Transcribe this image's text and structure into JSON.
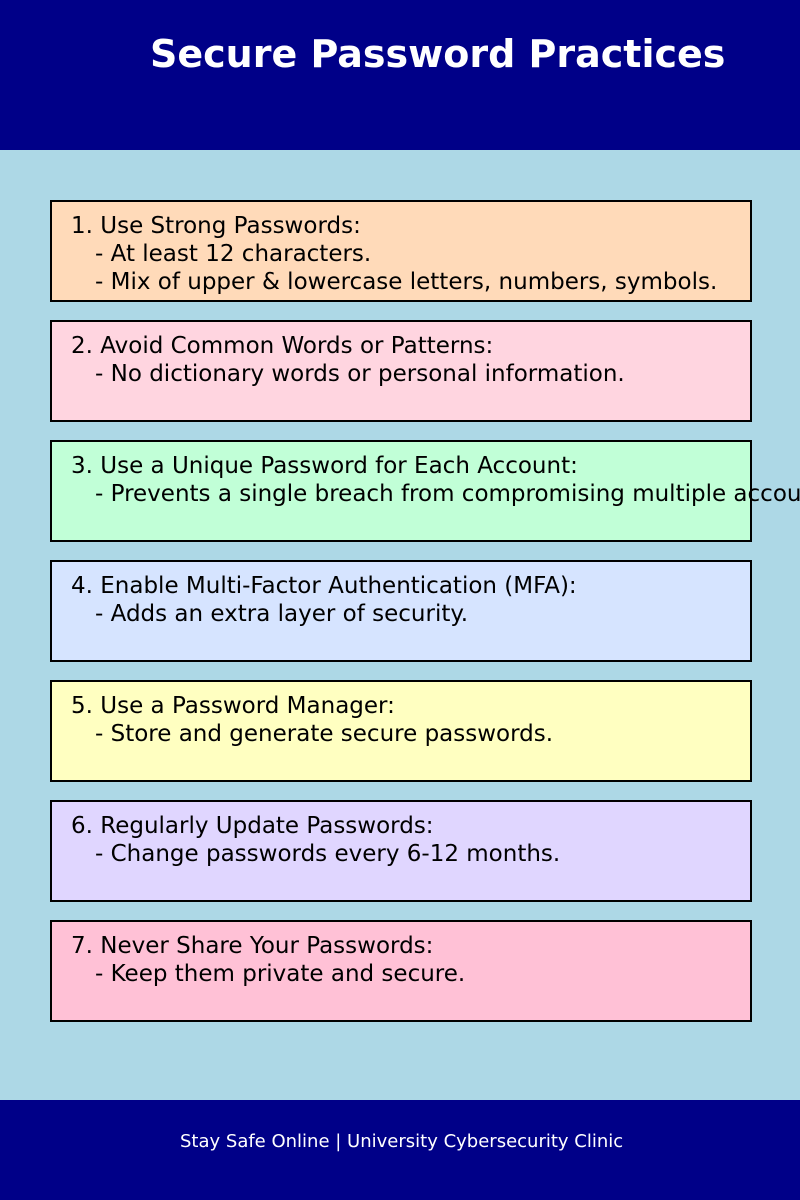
{
  "header": {
    "title": "Secure Password Practices",
    "background": "#000088"
  },
  "page": {
    "background": "#add8e6"
  },
  "tips": [
    {
      "heading": "1. Use Strong Passwords:",
      "details": [
        "- At least 12 characters.",
        "- Mix of upper & lowercase letters, numbers, symbols."
      ],
      "color": "#ffdab9"
    },
    {
      "heading": "2. Avoid Common Words or Patterns:",
      "details": [
        "- No dictionary words or personal information."
      ],
      "color": "#ffd5e0"
    },
    {
      "heading": "3. Use a Unique Password for Each Account:",
      "details": [
        "- Prevents a single breach from compromising multiple accounts."
      ],
      "color": "#c1ffd7"
    },
    {
      "heading": "4. Enable Multi-Factor Authentication (MFA):",
      "details": [
        "- Adds an extra layer of security."
      ],
      "color": "#d6e4ff"
    },
    {
      "heading": "5. Use a Password Manager:",
      "details": [
        "- Store and generate secure passwords."
      ],
      "color": "#ffffc1"
    },
    {
      "heading": "6. Regularly Update Passwords:",
      "details": [
        "- Change passwords every 6-12 months."
      ],
      "color": "#e0d6ff"
    },
    {
      "heading": "7. Never Share Your Passwords:",
      "details": [
        "- Keep them private and secure."
      ],
      "color": "#ffc1d6"
    }
  ],
  "footer": {
    "text": "Stay Safe Online | University Cybersecurity Clinic",
    "background": "#000088"
  }
}
